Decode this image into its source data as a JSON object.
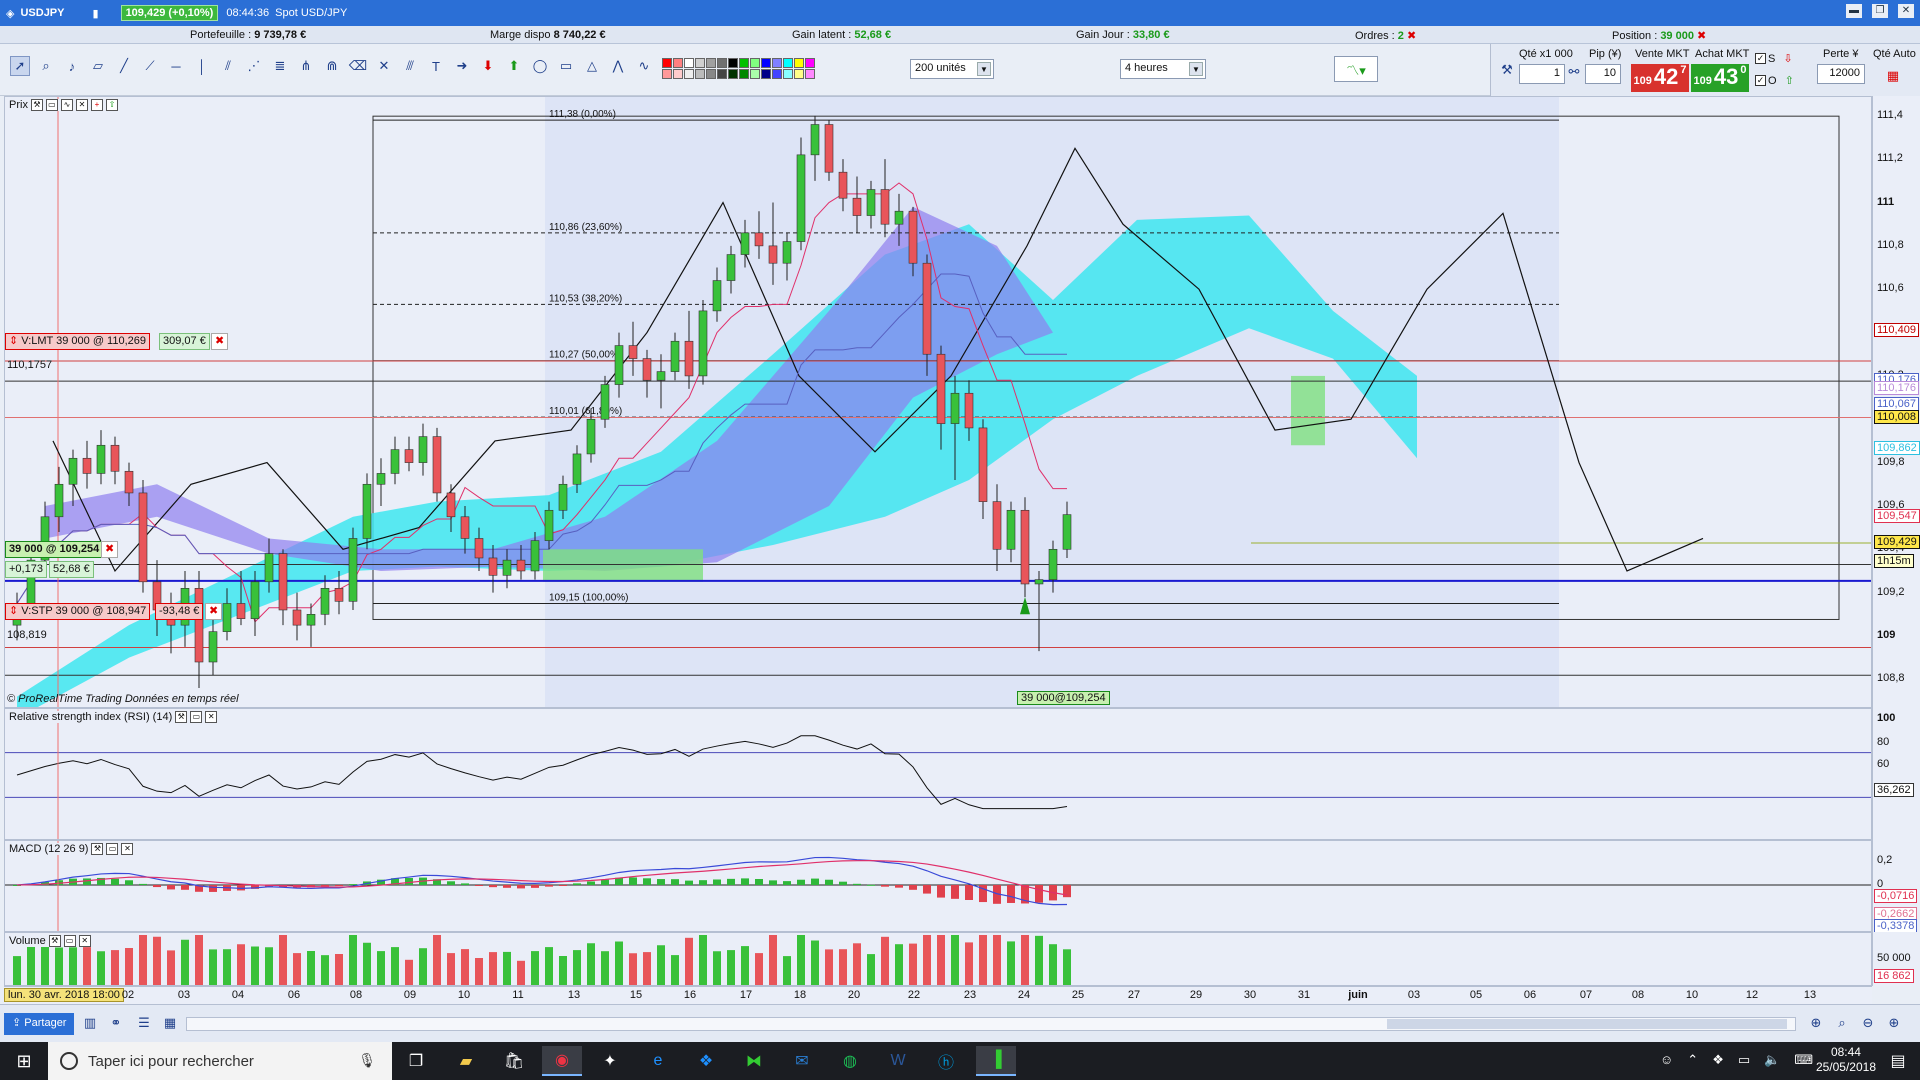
{
  "titlebar": {
    "symbol": "USDJPY",
    "quote": "109,429 (+0,10%)",
    "time": "08:44:36",
    "name": "Spot USD/JPY",
    "controls": [
      "▬",
      "❐",
      "✕"
    ]
  },
  "account": {
    "portfolio_label": "Portefeuille :",
    "portfolio": "9 739,78 €",
    "margin_label": "Marge dispo",
    "margin": "8 740,22 €",
    "latent_label": "Gain latent :",
    "latent": "52,68 €",
    "day_label": "Gain Jour :",
    "day": "33,80 €",
    "orders_label": "Ordres :",
    "orders": "2",
    "position_label": "Position :",
    "position": "39 000"
  },
  "toolbar": {
    "units": "200 unités",
    "timeframe": "4 heures",
    "colors": [
      "#ff0000",
      "#ff8080",
      "#ffffff",
      "#d0d0d0",
      "#a0a0a0",
      "#707070",
      "#000000",
      "#00c000",
      "#80ff80",
      "#0000ff",
      "#8080ff",
      "#00ffff",
      "#ffff00",
      "#ff00ff",
      "#ff9999",
      "#ffcccc",
      "#eeeeee",
      "#bbbbbb",
      "#888888",
      "#444444",
      "#003300",
      "#008800",
      "#aaffaa",
      "#000088",
      "#4444ff",
      "#88ffff",
      "#ffff88",
      "#ff88ff"
    ]
  },
  "ticket": {
    "qty_label": "Qté x1 000",
    "qty": "1",
    "pip_label": "Pip (¥)",
    "pip": "10",
    "sell_label": "Vente MKT",
    "sell_small": "109",
    "sell_big": "42",
    "sell_sup": "7",
    "buy_label": "Achat MKT",
    "buy_small": "109",
    "buy_big": "43",
    "buy_sup": "0",
    "s_label": "S",
    "o_label": "O",
    "loss_label": "Perte ¥",
    "loss": "12000",
    "auto_label": "Qté Auto"
  },
  "price_pane": {
    "title": "Prix",
    "watermark": "© ProRealTime Trading  Données en temps réel",
    "limit_order": {
      "label": "V:LMT  39 000 @ 110,269",
      "pnl": "309,07 €"
    },
    "position": {
      "label": "39 000 @ 109,254",
      "change": "+0,173",
      "pnl": "52,68 €"
    },
    "stop_order": {
      "label": "V:STP  39 000 @ 108,947",
      "pnl": "-93,48 €"
    },
    "left_level_1": "110,1757",
    "left_level_2": "108,819",
    "fill_label": "39 000@109,254",
    "fib": [
      {
        "label": "111,38 (0,00%)",
        "price": 111.38,
        "style": "solid"
      },
      {
        "label": "110,86 (23,60%)",
        "price": 110.86,
        "style": "dashed"
      },
      {
        "label": "110,53 (38,20%)",
        "price": 110.53,
        "style": "dashed"
      },
      {
        "label": "110,27 (50,00%)",
        "price": 110.27,
        "style": "solid"
      },
      {
        "label": "110,01 (61,80%)",
        "price": 110.01,
        "style": "dashed"
      },
      {
        "label": "109,15 (100,00%)",
        "price": 109.15,
        "style": "solid"
      }
    ],
    "axis_ticks": [
      "111,4",
      "111,2",
      "111",
      "110,8",
      "110,6",
      "110,4",
      "110,2",
      "110",
      "109,8",
      "109,6",
      "109,4",
      "109,2",
      "109",
      "108,8"
    ],
    "axis_tags": [
      {
        "text": "110,409",
        "price": 110.409,
        "color": "#c00000",
        "fill": "#ffffff"
      },
      {
        "text": "110,176",
        "price": 110.176,
        "color": "#4a62c8",
        "fill": "#ffffff"
      },
      {
        "text": "110,176",
        "price": 110.14,
        "color": "#b88ad8",
        "fill": "#ffffff"
      },
      {
        "text": "110,067",
        "price": 110.067,
        "color": "#4a62c8",
        "fill": "#ffffff"
      },
      {
        "text": "110,008",
        "price": 110.008,
        "color": "#111111",
        "fill": "#ffe74a"
      },
      {
        "text": "109,862",
        "price": 109.862,
        "color": "#2ec0e0",
        "fill": "#ffffff"
      },
      {
        "text": "109,547",
        "price": 109.547,
        "color": "#e03050",
        "fill": "#ffffff"
      },
      {
        "text": "109,429",
        "price": 109.429,
        "color": "#111111",
        "fill": "#ffe74a"
      },
      {
        "text": "1h15m",
        "price": 109.34,
        "color": "#111111",
        "fill": "#ffffcc"
      }
    ]
  },
  "rsi_pane": {
    "title": "Relative strength index (RSI) (14)",
    "ticks": [
      "100",
      "80",
      "60"
    ],
    "value": "36,262"
  },
  "macd_pane": {
    "title": "MACD (12 26 9)",
    "ticks": [
      "0,2",
      "0"
    ],
    "tags": [
      "-0,0716",
      "-0,2662",
      "-0,3378"
    ]
  },
  "volume_pane": {
    "title": "Volume",
    "ticks": [
      "50 000"
    ],
    "value": "16 862"
  },
  "date_axis": {
    "first": "lun. 30 avr. 2018 18:00",
    "labels": [
      "02",
      "03",
      "04",
      "06",
      "08",
      "09",
      "10",
      "11",
      "13",
      "15",
      "16",
      "17",
      "18",
      "20",
      "22",
      "23",
      "24",
      "25",
      "27",
      "29",
      "30",
      "31",
      "juin",
      "03",
      "05",
      "06",
      "07",
      "08",
      "10",
      "12",
      "13"
    ]
  },
  "appbar": {
    "share": "Partager"
  },
  "taskbar": {
    "search": "Taper ici pour rechercher",
    "time": "08:44",
    "date": "25/05/2018"
  },
  "chart_data": {
    "type": "candlestick",
    "symbol": "USDJPY",
    "timeframe": "4 heures",
    "ylim": [
      108.7,
      111.45
    ],
    "candles": [
      [
        109.05,
        109.2,
        108.98,
        109.15
      ],
      [
        109.15,
        109.4,
        109.1,
        109.35
      ],
      [
        109.35,
        109.62,
        109.3,
        109.55
      ],
      [
        109.55,
        109.78,
        109.48,
        109.7
      ],
      [
        109.7,
        109.86,
        109.6,
        109.82
      ],
      [
        109.82,
        109.9,
        109.68,
        109.75
      ],
      [
        109.75,
        109.95,
        109.7,
        109.88
      ],
      [
        109.88,
        109.92,
        109.7,
        109.76
      ],
      [
        109.76,
        109.8,
        109.6,
        109.66
      ],
      [
        109.66,
        109.72,
        109.2,
        109.25
      ],
      [
        109.25,
        109.35,
        109.0,
        109.12
      ],
      [
        109.12,
        109.2,
        108.92,
        109.05
      ],
      [
        109.05,
        109.3,
        108.95,
        109.22
      ],
      [
        109.22,
        109.3,
        108.76,
        108.88
      ],
      [
        108.88,
        109.1,
        108.82,
        109.02
      ],
      [
        109.02,
        109.22,
        108.98,
        109.15
      ],
      [
        109.15,
        109.3,
        109.05,
        109.08
      ],
      [
        109.08,
        109.3,
        109.0,
        109.25
      ],
      [
        109.25,
        109.45,
        109.2,
        109.38
      ],
      [
        109.38,
        109.4,
        109.05,
        109.12
      ],
      [
        109.12,
        109.2,
        108.98,
        109.05
      ],
      [
        109.05,
        109.15,
        108.95,
        109.1
      ],
      [
        109.1,
        109.28,
        109.05,
        109.22
      ],
      [
        109.22,
        109.3,
        109.1,
        109.16
      ],
      [
        109.16,
        109.5,
        109.12,
        109.45
      ],
      [
        109.45,
        109.75,
        109.4,
        109.7
      ],
      [
        109.7,
        109.82,
        109.6,
        109.75
      ],
      [
        109.75,
        109.92,
        109.7,
        109.86
      ],
      [
        109.86,
        109.92,
        109.76,
        109.8
      ],
      [
        109.8,
        109.98,
        109.74,
        109.92
      ],
      [
        109.92,
        109.96,
        109.62,
        109.66
      ],
      [
        109.66,
        109.7,
        109.48,
        109.55
      ],
      [
        109.55,
        109.6,
        109.38,
        109.45
      ],
      [
        109.45,
        109.5,
        109.3,
        109.36
      ],
      [
        109.36,
        109.42,
        109.2,
        109.28
      ],
      [
        109.28,
        109.4,
        109.22,
        109.35
      ],
      [
        109.35,
        109.42,
        109.26,
        109.3
      ],
      [
        109.3,
        109.48,
        109.26,
        109.44
      ],
      [
        109.44,
        109.62,
        109.4,
        109.58
      ],
      [
        109.58,
        109.74,
        109.54,
        109.7
      ],
      [
        109.7,
        109.88,
        109.66,
        109.84
      ],
      [
        109.84,
        110.05,
        109.8,
        110.0
      ],
      [
        110.0,
        110.2,
        109.96,
        110.16
      ],
      [
        110.16,
        110.4,
        110.1,
        110.34
      ],
      [
        110.34,
        110.45,
        110.2,
        110.28
      ],
      [
        110.28,
        110.32,
        110.1,
        110.18
      ],
      [
        110.18,
        110.3,
        110.05,
        110.22
      ],
      [
        110.22,
        110.4,
        110.18,
        110.36
      ],
      [
        110.36,
        110.5,
        110.14,
        110.2
      ],
      [
        110.2,
        110.55,
        110.16,
        110.5
      ],
      [
        110.5,
        110.7,
        110.45,
        110.64
      ],
      [
        110.64,
        110.8,
        110.58,
        110.76
      ],
      [
        110.76,
        110.92,
        110.7,
        110.86
      ],
      [
        110.86,
        110.96,
        110.74,
        110.8
      ],
      [
        110.8,
        111.0,
        110.62,
        110.72
      ],
      [
        110.72,
        110.86,
        110.64,
        110.82
      ],
      [
        110.82,
        111.3,
        110.78,
        111.22
      ],
      [
        111.22,
        111.4,
        111.1,
        111.36
      ],
      [
        111.36,
        111.38,
        111.1,
        111.14
      ],
      [
        111.14,
        111.2,
        110.96,
        111.02
      ],
      [
        111.02,
        111.12,
        110.86,
        110.94
      ],
      [
        110.94,
        111.1,
        110.88,
        111.06
      ],
      [
        111.06,
        111.2,
        110.84,
        110.9
      ],
      [
        110.9,
        111.04,
        110.8,
        110.96
      ],
      [
        110.96,
        110.98,
        110.66,
        110.72
      ],
      [
        110.72,
        110.76,
        110.2,
        110.3
      ],
      [
        110.3,
        110.34,
        109.86,
        109.98
      ],
      [
        109.98,
        110.2,
        109.72,
        110.12
      ],
      [
        110.12,
        110.18,
        109.9,
        109.96
      ],
      [
        109.96,
        110.0,
        109.54,
        109.62
      ],
      [
        109.62,
        109.7,
        109.3,
        109.4
      ],
      [
        109.4,
        109.62,
        109.34,
        109.58
      ],
      [
        109.58,
        109.64,
        109.18,
        109.24
      ],
      [
        109.24,
        109.3,
        108.93,
        109.26
      ],
      [
        109.26,
        109.44,
        109.2,
        109.4
      ],
      [
        109.4,
        109.62,
        109.36,
        109.56
      ]
    ]
  }
}
